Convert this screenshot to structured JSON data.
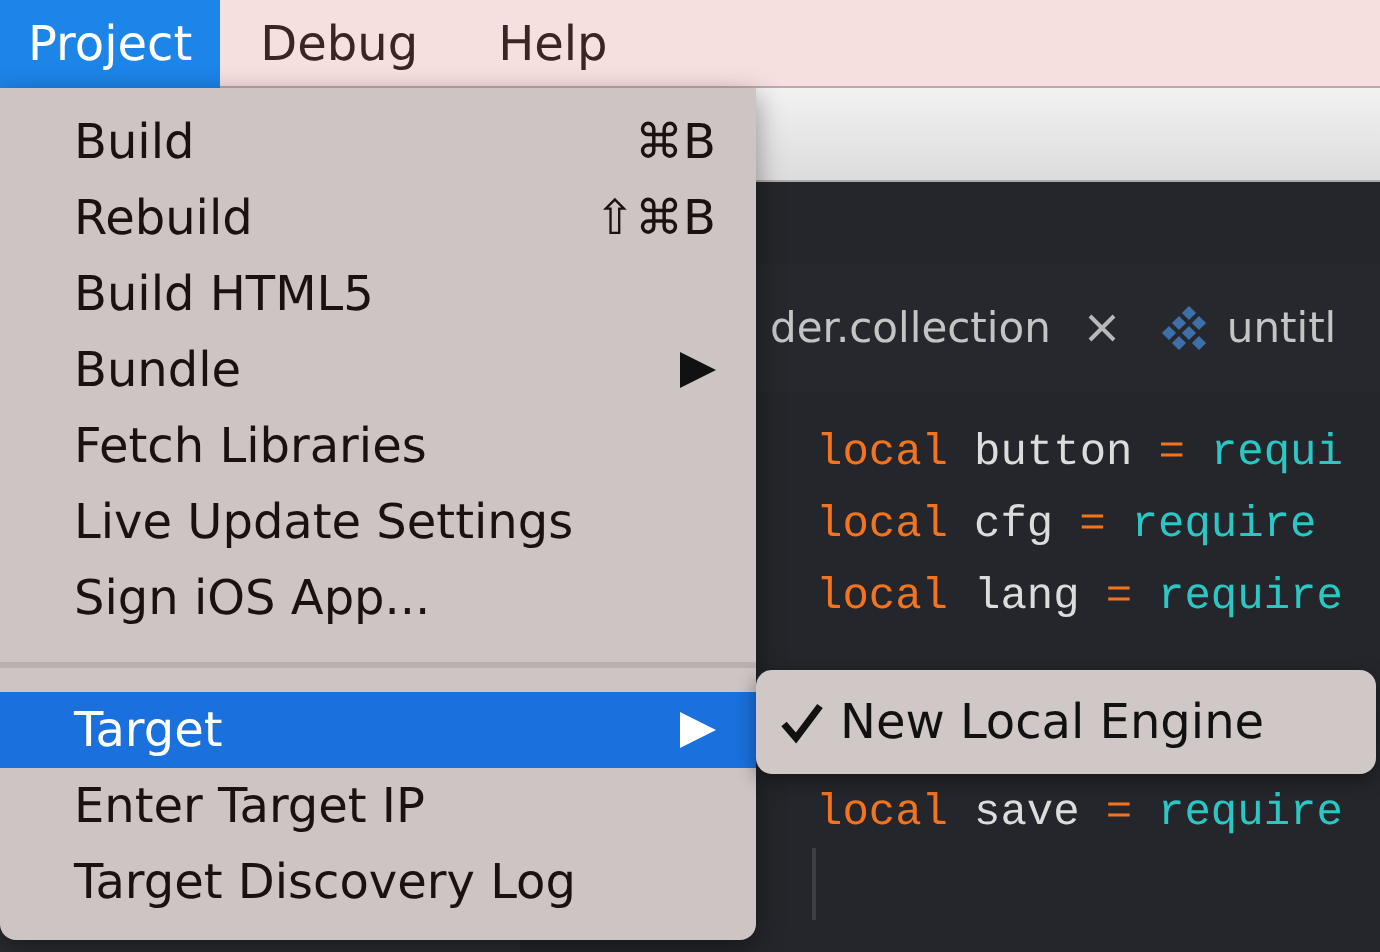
{
  "menubar": [
    {
      "label": "Project",
      "selected": true
    },
    {
      "label": "Debug",
      "selected": false
    },
    {
      "label": "Help",
      "selected": false
    }
  ],
  "menu": [
    {
      "kind": "item",
      "label": "Build",
      "shortcut": "⌘B",
      "selected": false
    },
    {
      "kind": "item",
      "label": "Rebuild",
      "shortcut": "⇧⌘B",
      "selected": false
    },
    {
      "kind": "item",
      "label": "Build HTML5",
      "selected": false
    },
    {
      "kind": "submenu",
      "label": "Bundle",
      "selected": false
    },
    {
      "kind": "item",
      "label": "Fetch Libraries",
      "selected": false
    },
    {
      "kind": "item",
      "label": "Live Update Settings",
      "selected": false
    },
    {
      "kind": "item",
      "label": "Sign iOS App...",
      "selected": false
    },
    {
      "kind": "separator"
    },
    {
      "kind": "submenu",
      "label": "Target",
      "selected": true
    },
    {
      "kind": "item",
      "label": "Enter Target IP",
      "selected": false
    },
    {
      "kind": "item",
      "label": "Target Discovery Log",
      "selected": false
    }
  ],
  "submenu": [
    {
      "label": "New Local Engine",
      "checked": true
    }
  ],
  "tabs": [
    {
      "label": "der.collection",
      "closable": true
    },
    {
      "label": "untitl",
      "closable": false
    }
  ],
  "code": [
    {
      "tokens": [
        {
          "kind": "keyword",
          "text": "local"
        },
        {
          "kind": "name",
          "text": "button"
        },
        {
          "kind": "op",
          "text": "="
        },
        {
          "kind": "call",
          "text": "requi"
        }
      ]
    },
    {
      "tokens": [
        {
          "kind": "keyword",
          "text": "local"
        },
        {
          "kind": "name",
          "text": "cfg"
        },
        {
          "kind": "op",
          "text": "="
        },
        {
          "kind": "call",
          "text": "require"
        }
      ]
    },
    {
      "tokens": [
        {
          "kind": "keyword",
          "text": "local"
        },
        {
          "kind": "name",
          "text": "lang"
        },
        {
          "kind": "op",
          "text": "="
        },
        {
          "kind": "call",
          "text": "require"
        }
      ]
    }
  ],
  "code_below_submenu": [
    {
      "kind": "code",
      "tokens": [
        {
          "kind": "keyword",
          "text": "local"
        },
        {
          "kind": "name",
          "text": "save"
        },
        {
          "kind": "op",
          "text": "="
        },
        {
          "kind": "call",
          "text": "require"
        }
      ]
    },
    {
      "kind": "blank"
    }
  ]
}
